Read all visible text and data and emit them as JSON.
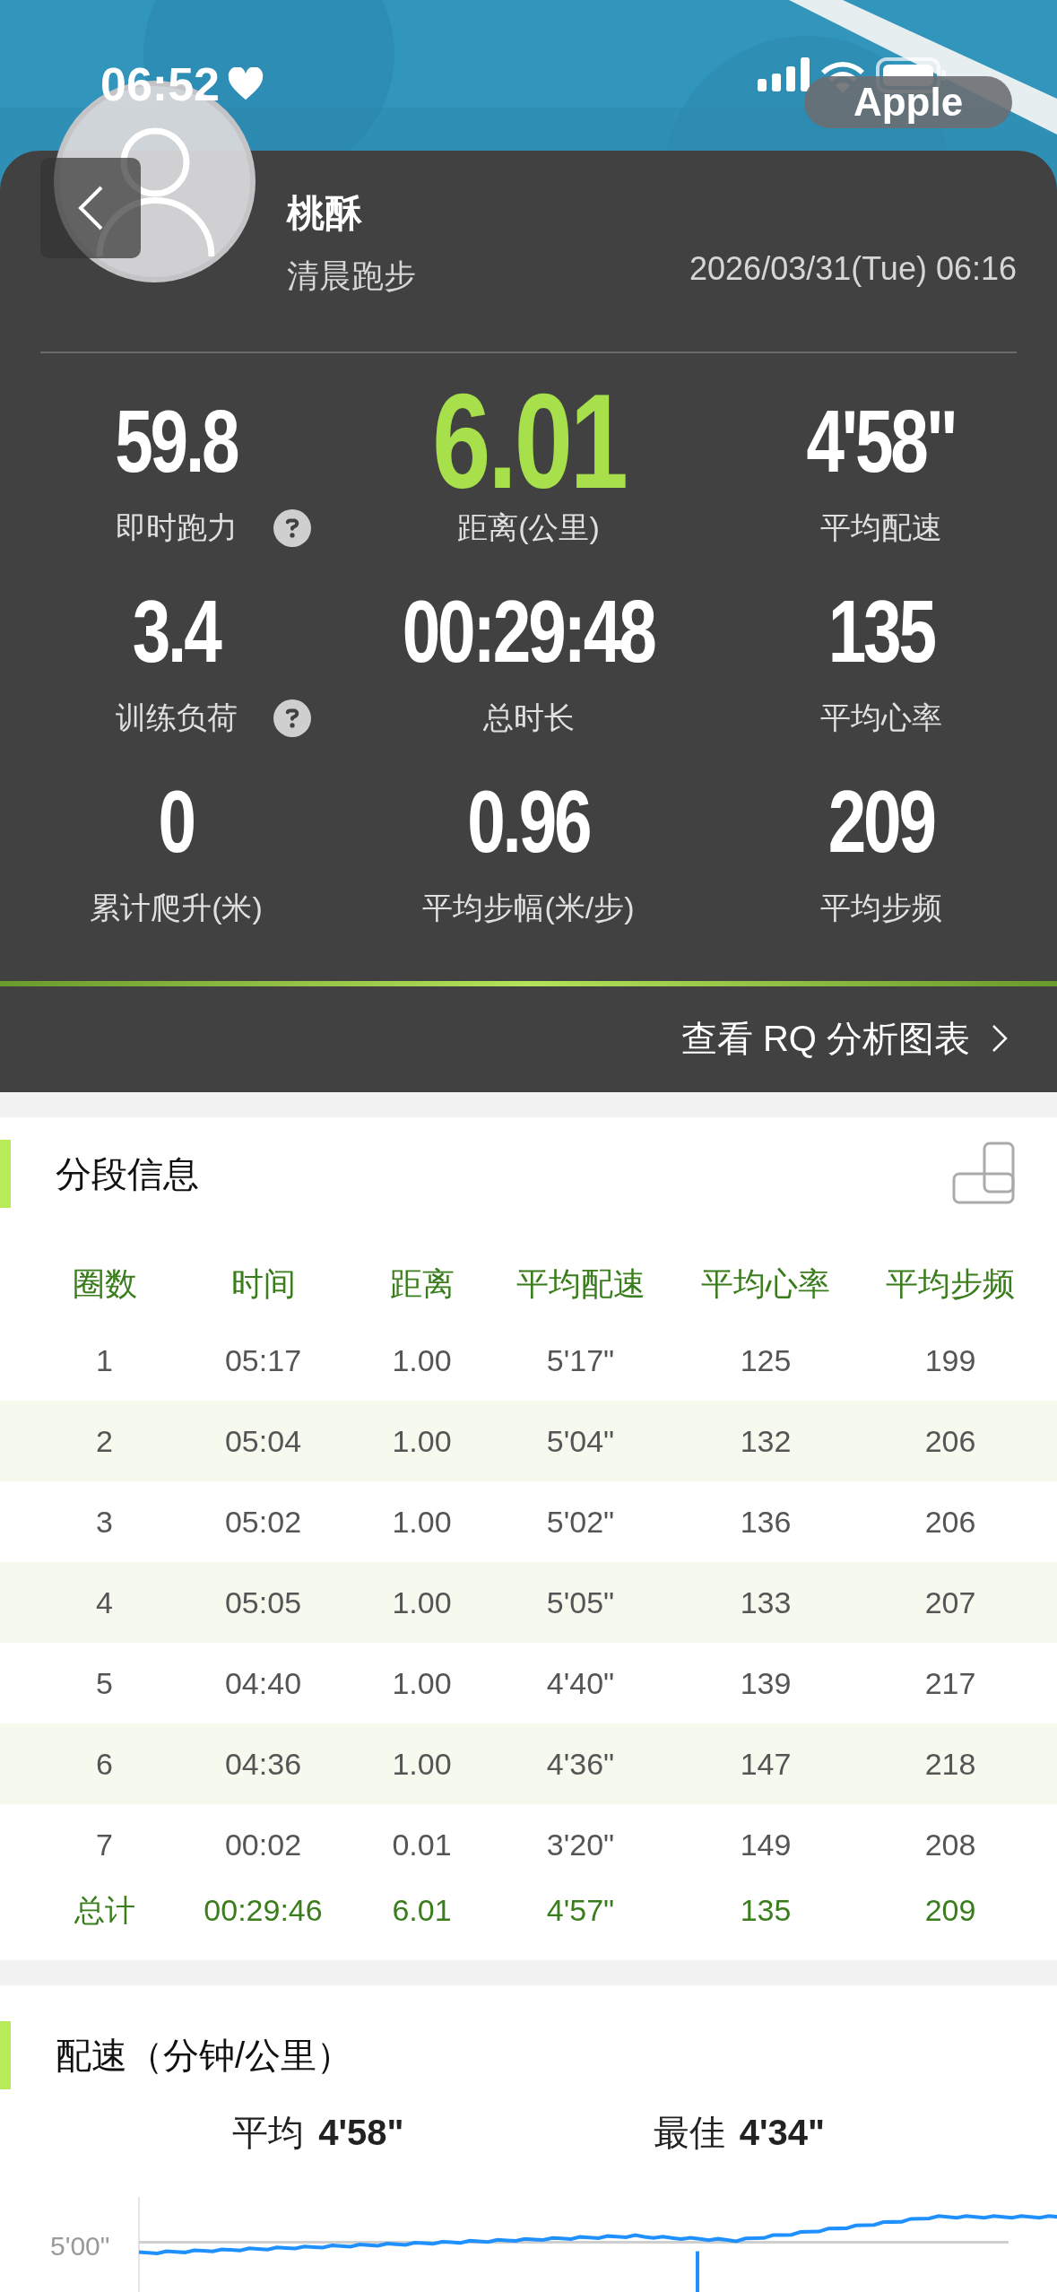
{
  "status_bar": {
    "time": "06:52",
    "pill": "Apple"
  },
  "profile": {
    "name": "桃酥",
    "activity": "清晨跑步",
    "datetime": "2026/03/31(Tue) 06:16"
  },
  "stats": [
    {
      "value": "59.8",
      "label": "即时跑力",
      "help": true,
      "highlight": false
    },
    {
      "value": "6.01",
      "label": "距离(公里)",
      "highlight": true
    },
    {
      "value": "4'58\"",
      "label": "平均配速",
      "highlight": false
    },
    {
      "value": "3.4",
      "label": "训练负荷",
      "help": true,
      "highlight": false
    },
    {
      "value": "00:29:48",
      "label": "总时长",
      "highlight": false
    },
    {
      "value": "135",
      "label": "平均心率",
      "highlight": false
    },
    {
      "value": "0",
      "label": "累计爬升(米)",
      "highlight": false
    },
    {
      "value": "0.96",
      "label": "平均步幅(米/步)",
      "highlight": false
    },
    {
      "value": "209",
      "label": "平均步频",
      "highlight": false
    }
  ],
  "rq_link": "查看 RQ 分析图表",
  "laps": {
    "title": "分段信息",
    "columns": [
      "圈数",
      "时间",
      "距离",
      "平均配速",
      "平均心率",
      "平均步频"
    ],
    "rows": [
      {
        "kind": "lap",
        "cells": [
          "1",
          "05:17",
          "1.00",
          "5'17\"",
          "125",
          "199"
        ]
      },
      {
        "kind": "lap",
        "cells": [
          "2",
          "05:04",
          "1.00",
          "5'04\"",
          "132",
          "206"
        ]
      },
      {
        "kind": "lap",
        "cells": [
          "3",
          "05:02",
          "1.00",
          "5'02\"",
          "136",
          "206"
        ]
      },
      {
        "kind": "lap",
        "cells": [
          "4",
          "05:05",
          "1.00",
          "5'05\"",
          "133",
          "207"
        ]
      },
      {
        "kind": "lap",
        "cells": [
          "5",
          "04:40",
          "1.00",
          "4'40\"",
          "139",
          "217"
        ]
      },
      {
        "kind": "lap",
        "cells": [
          "6",
          "04:36",
          "1.00",
          "4'36\"",
          "147",
          "218"
        ]
      },
      {
        "kind": "lap",
        "cells": [
          "7",
          "00:02",
          "0.01",
          "3'20\"",
          "149",
          "208"
        ]
      },
      {
        "kind": "total",
        "cells": [
          "总计",
          "00:29:46",
          "6.01",
          "4'57\"",
          "135",
          "209"
        ]
      }
    ]
  },
  "pace": {
    "title": "配速（分钟/公里）",
    "summary": [
      {
        "label": "平均",
        "value": "4'58\""
      },
      {
        "label": "最佳",
        "value": "4'34\""
      }
    ],
    "axis_label": "5'00\""
  }
}
